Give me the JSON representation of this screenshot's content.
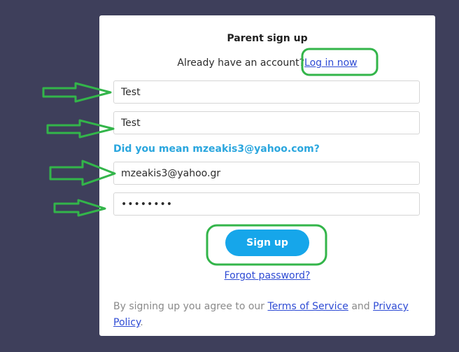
{
  "form": {
    "title": "Parent sign up",
    "already_prefix": "Already have an account?",
    "login_link": "Log in now",
    "first_name_value": "Test",
    "last_name_value": "Test",
    "email_suggestion": "Did you mean mzeakis3@yahoo.com?",
    "email_value": "mzeakis3@yahoo.gr",
    "password_value": "password",
    "signup_label": "Sign up",
    "forgot_label": "Forgot password?",
    "terms_prefix": "By signing up you agree to our",
    "terms_link": "Terms of Service",
    "terms_and": "and",
    "privacy_link": "Privacy Policy",
    "terms_suffix": "."
  },
  "colors": {
    "background": "#3e3f5b",
    "card": "#ffffff",
    "button": "#16a6ea",
    "link": "#2e4bd4",
    "suggestion": "#2aa6de",
    "annotation": "#33b54a"
  },
  "annotations": {
    "arrow_icon": "right-arrow-icon",
    "highlight_shape": "rounded-rectangle"
  }
}
